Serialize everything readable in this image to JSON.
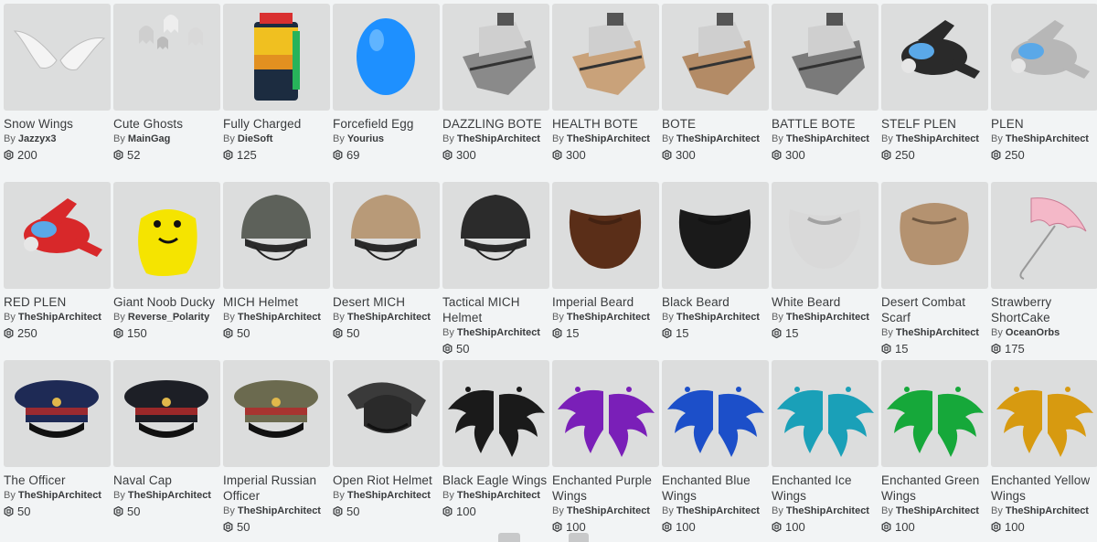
{
  "items": [
    {
      "name": "Snow Wings",
      "creator": "Jazzyx3",
      "price": "200",
      "icon": "snow-wings-icon",
      "color": "#e8e8e8"
    },
    {
      "name": "Cute Ghosts",
      "creator": "MainGag",
      "price": "52",
      "icon": "cute-ghosts-icon",
      "color": "#cfcfcf"
    },
    {
      "name": "Fully Charged",
      "creator": "DieSoft",
      "price": "125",
      "icon": "battery-icon",
      "color": "#f0c020"
    },
    {
      "name": "Forcefield Egg",
      "creator": "Yourius",
      "price": "69",
      "icon": "egg-icon",
      "color": "#1e90ff"
    },
    {
      "name": "DAZZLING BOTE",
      "creator": "TheShipArchitect",
      "price": "300",
      "icon": "ship-icon",
      "color": "#8a8a8a"
    },
    {
      "name": "HEALTH BOTE",
      "creator": "TheShipArchitect",
      "price": "300",
      "icon": "ship-icon",
      "color": "#c9a27a"
    },
    {
      "name": "BOTE",
      "creator": "TheShipArchitect",
      "price": "300",
      "icon": "ship-icon",
      "color": "#b38b66"
    },
    {
      "name": "BATTLE BOTE",
      "creator": "TheShipArchitect",
      "price": "300",
      "icon": "ship-icon",
      "color": "#7a7a7a"
    },
    {
      "name": "STELF PLEN",
      "creator": "TheShipArchitect",
      "price": "250",
      "icon": "plane-icon",
      "color": "#2a2a2a"
    },
    {
      "name": "PLEN",
      "creator": "TheShipArchitect",
      "price": "250",
      "icon": "plane-icon",
      "color": "#b7b7b7"
    },
    {
      "name": "RED PLEN",
      "creator": "TheShipArchitect",
      "price": "250",
      "icon": "plane-icon",
      "color": "#d8282a"
    },
    {
      "name": "Giant Noob Ducky",
      "creator": "Reverse_Polarity",
      "price": "150",
      "icon": "duck-icon",
      "color": "#f5e400"
    },
    {
      "name": "MICH Helmet",
      "creator": "TheShipArchitect",
      "price": "50",
      "icon": "helmet-icon",
      "color": "#5d615a"
    },
    {
      "name": "Desert MICH",
      "creator": "TheShipArchitect",
      "price": "50",
      "icon": "helmet-icon",
      "color": "#b89a78"
    },
    {
      "name": "Tactical MICH Helmet",
      "creator": "TheShipArchitect",
      "price": "50",
      "icon": "helmet-icon",
      "color": "#2b2b2b"
    },
    {
      "name": "Imperial Beard",
      "creator": "TheShipArchitect",
      "price": "15",
      "icon": "beard-icon",
      "color": "#5a2e18"
    },
    {
      "name": "Black Beard",
      "creator": "TheShipArchitect",
      "price": "15",
      "icon": "beard-icon",
      "color": "#1a1a1a"
    },
    {
      "name": "White Beard",
      "creator": "TheShipArchitect",
      "price": "15",
      "icon": "beard-icon",
      "color": "#d9d9d9"
    },
    {
      "name": "Desert Combat Scarf",
      "creator": "TheShipArchitect",
      "price": "15",
      "icon": "scarf-icon",
      "color": "#b49270"
    },
    {
      "name": "Strawberry ShortCake",
      "creator": "OceanOrbs",
      "price": "175",
      "icon": "umbrella-icon",
      "color": "#f4b8c8"
    },
    {
      "name": "The Officer",
      "creator": "TheShipArchitect",
      "price": "50",
      "icon": "officer-cap-icon",
      "color": "#1e2a55"
    },
    {
      "name": "Naval Cap",
      "creator": "TheShipArchitect",
      "price": "50",
      "icon": "officer-cap-icon",
      "color": "#1d1f26"
    },
    {
      "name": "Imperial Russian Officer",
      "creator": "TheShipArchitect",
      "price": "50",
      "icon": "officer-cap-icon",
      "color": "#6b6a4f"
    },
    {
      "name": "Open Riot Helmet",
      "creator": "TheShipArchitect",
      "price": "50",
      "icon": "riot-helmet-icon",
      "color": "#3a3a3a"
    },
    {
      "name": "Black Eagle Wings",
      "creator": "TheShipArchitect",
      "price": "100",
      "icon": "eagle-wings-icon",
      "color": "#1a1a1a"
    },
    {
      "name": "Enchanted Purple Wings",
      "creator": "TheShipArchitect",
      "price": "100",
      "icon": "eagle-wings-icon",
      "color": "#7a1fb8"
    },
    {
      "name": "Enchanted Blue Wings",
      "creator": "TheShipArchitect",
      "price": "100",
      "icon": "eagle-wings-icon",
      "color": "#1c4fc9"
    },
    {
      "name": "Enchanted Ice Wings",
      "creator": "TheShipArchitect",
      "price": "100",
      "icon": "eagle-wings-icon",
      "color": "#1aa0b8"
    },
    {
      "name": "Enchanted Green Wings",
      "creator": "TheShipArchitect",
      "price": "100",
      "icon": "eagle-wings-icon",
      "color": "#16a83a"
    },
    {
      "name": "Enchanted Yellow Wings",
      "creator": "TheShipArchitect",
      "price": "100",
      "icon": "eagle-wings-icon",
      "color": "#d79a10"
    }
  ],
  "by_prefix": "By",
  "currency_icon": "robux-icon"
}
